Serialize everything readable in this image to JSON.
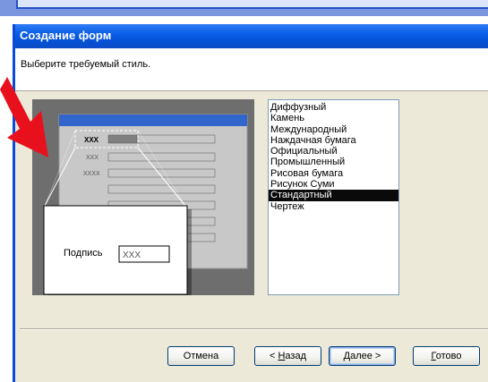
{
  "window": {
    "title": "Создание форм",
    "prompt": "Выберите требуемый стиль."
  },
  "preview": {
    "row_label_1": "XXX",
    "row_label_2": "XXX",
    "row_label_3": "XXXX",
    "caption_label": "Подпись",
    "caption_value": "XXX"
  },
  "styles": {
    "items": [
      "Диффузный",
      "Камень",
      "Международный",
      "Наждачная бумага",
      "Официальный",
      "Промышленный",
      "Рисовая бумага",
      "Рисунок Суми",
      "Стандартный",
      "Чертеж"
    ],
    "selected_index": 8
  },
  "buttons": {
    "cancel": "Отмена",
    "back_prefix": "< ",
    "back_mnemonic": "Н",
    "back_rest": "азад",
    "next_mnemonic": "Д",
    "next_rest": "алее >",
    "finish_mnemonic": "Г",
    "finish_rest": "отово"
  },
  "colors": {
    "titlebar": "#0a5ee6",
    "arrow": "#e8101c",
    "selection": "#0a0a0a"
  }
}
